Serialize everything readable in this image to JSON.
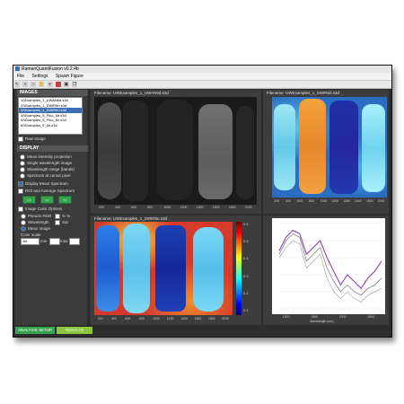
{
  "window": {
    "title": "RamanQuantiFusion v0.2.4b"
  },
  "menu": [
    "File",
    "Settings",
    "Spawn Figure"
  ],
  "toolbar": {
    "icons": [
      "arrow-icon",
      "zoom-in-icon",
      "zoom-out-icon",
      "pan-icon",
      "cursor-icon",
      "color-icon",
      "save-icon",
      "copy-icon"
    ]
  },
  "images_panel": {
    "header": "IMAGES",
    "files": [
      "1/\\Examples_1_UWAN6d.s3d",
      "2/\\Examples_1_SWIR6n.s3d",
      "3/\\Examples_1_SWIR6d.s3d",
      "4/\\Examples_5_Fluo_6d.s3d",
      "5/\\Examples_5_Fluo_6n.s3d",
      "6/\\Examples_5_6b.s3d"
    ],
    "selected_index": 2,
    "raw_image_label": "Raw Image"
  },
  "display_panel": {
    "header": "DISPLAY",
    "options": [
      "Mean intensity projection",
      "Single wavelength image",
      "Wavelength range (bands)",
      "Spectrum at cursor pixel"
    ],
    "display_mean_spectrum": "Display Mean Spectrum",
    "roi_label": "ROI and Average Spectrum",
    "buttons": [
      "<<",
      ">>",
      "+/-"
    ],
    "image_color_options": "Image Color Options",
    "pseudo_rgb": "Pseudo RGB",
    "wavelength": "Wavelength",
    "mean_image": "Mean Image",
    "color_scale_label": "Color scale",
    "color_scale_value": "Jet",
    "min_label": "min",
    "max_label": "max",
    "check_a": "% %",
    "check_b": "Sat"
  },
  "panels": {
    "top_left": {
      "title": "Filename: UWExamples_1_UWAN6d.s3d",
      "xticks": [
        "200",
        "400",
        "600",
        "800",
        "1000",
        "1200",
        "1400",
        "1600",
        "1800",
        "2000"
      ]
    },
    "top_right": {
      "title": "Filename: UWExamples_1_SWIR6d.s3d",
      "xticks": [
        "200",
        "400",
        "600",
        "800",
        "1000",
        "1200",
        "1400",
        "1600",
        "1800",
        "2000"
      ],
      "ylabel": "Normalized Reflectance Counts"
    },
    "bottom_left": {
      "title": "Filename: UWExamples_1_SWIR6n.s3d",
      "xticks": [
        "200",
        "400",
        "600",
        "800",
        "1000",
        "1200",
        "1400",
        "1600",
        "1800",
        "2000"
      ],
      "colorbar": [
        "0.6",
        "0.5",
        "0.4",
        "0.3",
        "0.2",
        "0.1"
      ]
    },
    "bottom_right": {
      "title": "Spectrum of selected point (378,1171)",
      "xlabel": "Wavelength (nm)",
      "ylabel": "Reflectance",
      "xticks": [
        "1000",
        "1500",
        "2000",
        "2500"
      ]
    }
  },
  "tabs": [
    "ANALYSIS SETUP",
    "RESULTS"
  ],
  "chart_data": {
    "type": "line",
    "title": "Spectrum of selected point (378,1171)",
    "xlabel": "Wavelength (nm)",
    "ylabel": "Reflectance",
    "x": [
      1000,
      1100,
      1200,
      1300,
      1400,
      1500,
      1600,
      1700,
      1800,
      1900,
      2000,
      2100,
      2200,
      2300,
      2400,
      2500
    ],
    "series": [
      {
        "values": [
          2.2,
          2.6,
          2.8,
          2.7,
          2.1,
          2.3,
          2.5,
          2.0,
          1.6,
          1.2,
          1.5,
          1.3,
          1.1,
          1.4,
          1.6,
          1.9
        ]
      },
      {
        "values": [
          2.1,
          2.5,
          2.7,
          2.6,
          1.9,
          2.1,
          2.3,
          1.7,
          1.3,
          1.0,
          1.2,
          1.0,
          0.9,
          1.1,
          1.2,
          1.4
        ]
      },
      {
        "values": [
          2.0,
          2.3,
          2.5,
          2.4,
          1.7,
          1.9,
          2.1,
          1.4,
          1.0,
          0.8,
          1.0,
          0.8,
          0.7,
          0.9,
          1.0,
          1.1
        ]
      }
    ],
    "colors": [
      "#8e44ad",
      "#777777",
      "#aaaaaa"
    ]
  }
}
